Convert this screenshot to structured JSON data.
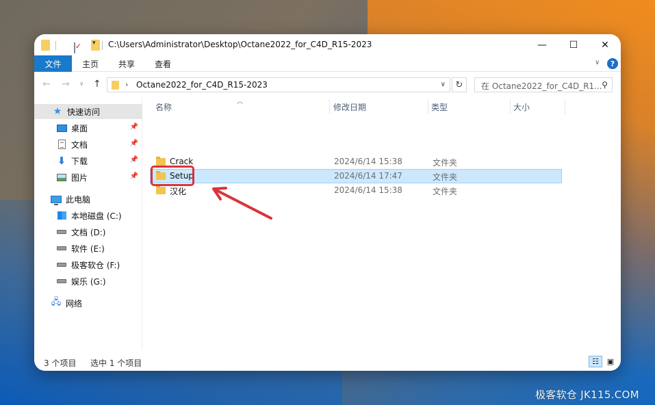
{
  "window": {
    "title_path": "C:\\Users\\Administrator\\Desktop\\Octane2022_for_C4D_R15-2023",
    "controls": {
      "minimize": "—",
      "maximize": "☐",
      "close": "✕"
    }
  },
  "ribbon": {
    "tabs": [
      "文件",
      "主页",
      "共享",
      "查看"
    ],
    "help": "?"
  },
  "navigation": {
    "address_text": "Octane2022_for_C4D_R15-2023",
    "search_placeholder": "在 Octane2022_for_C4D_R1...",
    "icons": [
      "back-arrow-icon",
      "forward-arrow-icon",
      "recent-chevron-icon",
      "up-arrow-icon",
      "refresh-icon",
      "search-icon"
    ]
  },
  "sidebar": {
    "quick_access": "快速访问",
    "pinned": [
      {
        "label": "桌面",
        "icon": "desktop-icon"
      },
      {
        "label": "文档",
        "icon": "documents-icon"
      },
      {
        "label": "下载",
        "icon": "downloads-icon"
      },
      {
        "label": "图片",
        "icon": "pictures-icon"
      }
    ],
    "this_pc": "此电脑",
    "drives": [
      {
        "label": "本地磁盘 (C:)",
        "icon": "system-drive-icon"
      },
      {
        "label": "文档 (D:)",
        "icon": "drive-icon"
      },
      {
        "label": "软件 (E:)",
        "icon": "drive-icon"
      },
      {
        "label": "极客软仓 (F:)",
        "icon": "drive-icon"
      },
      {
        "label": "娱乐 (G:)",
        "icon": "drive-icon"
      }
    ],
    "network": "网络"
  },
  "columns": {
    "name": "名称",
    "date": "修改日期",
    "type": "类型",
    "size": "大小"
  },
  "files": [
    {
      "name": "Crack",
      "date": "2024/6/14 15:38",
      "type": "文件夹",
      "selected": false
    },
    {
      "name": "Setup",
      "date": "2024/6/14 17:47",
      "type": "文件夹",
      "selected": true
    },
    {
      "name": "汉化",
      "date": "2024/6/14 15:38",
      "type": "文件夹",
      "selected": false
    }
  ],
  "status": {
    "item_count": "3 个项目",
    "selection": "选中 1 个项目"
  },
  "annotation": {
    "color": "#d9343a"
  },
  "watermark": "极客软仓 JK115.COM",
  "colors": {
    "accent": "#1979ca",
    "selection": "#cce8ff",
    "annotation": "#d9343a"
  }
}
